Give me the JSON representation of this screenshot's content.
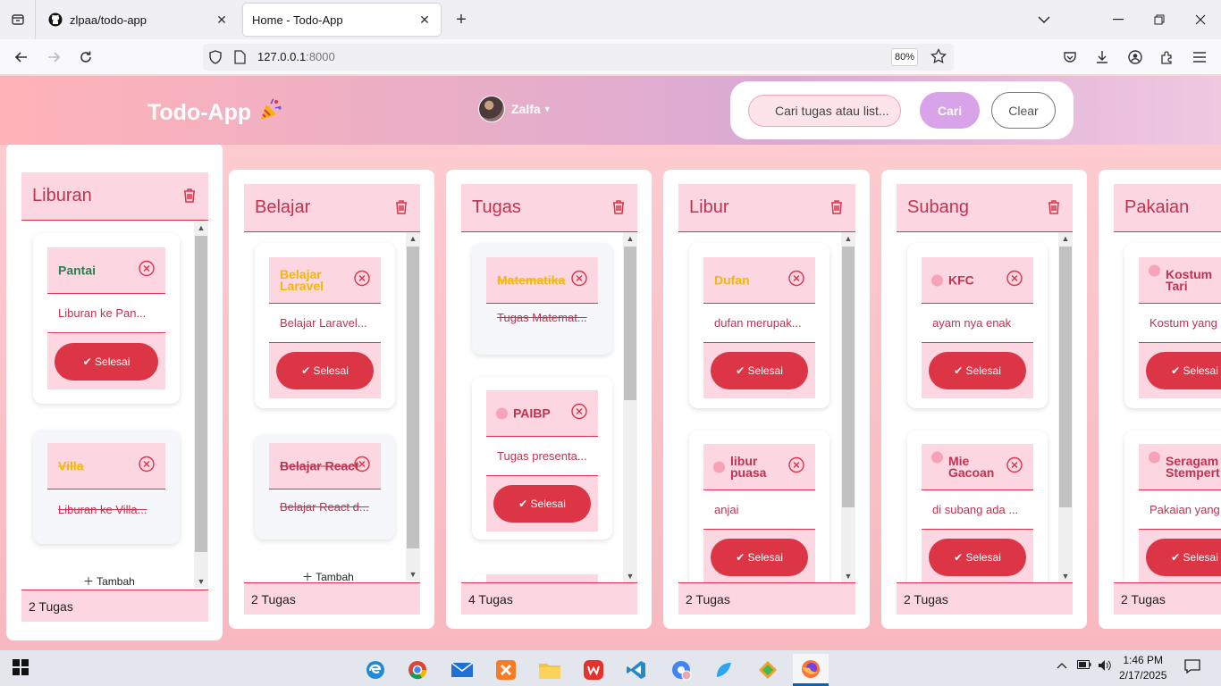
{
  "browser": {
    "tabs": [
      {
        "title": "zlpaa/todo-app"
      },
      {
        "title": "Home - Todo-App"
      }
    ],
    "url": {
      "host": "127.0.0.1",
      "port": ":8000"
    },
    "zoom": "80%"
  },
  "header": {
    "brand": "Todo-App",
    "user": "Zalfa",
    "search": {
      "placeholder": "Cari tugas atau list..."
    },
    "search_button": "Cari",
    "clear_button": "Clear"
  },
  "labels": {
    "selesai": "Selesai",
    "tambah": "Tambah"
  },
  "columns": [
    {
      "title": "Liburan",
      "count": "2 Tugas",
      "tasks": [
        {
          "title": "Pantai",
          "desc": "Liburan ke Pan...",
          "done": false
        },
        {
          "title": "Villa",
          "desc": "Liburan ke Villa...",
          "done": true
        }
      ]
    },
    {
      "title": "Belajar",
      "count": "2 Tugas",
      "tasks": [
        {
          "title": "Belajar Laravel",
          "desc": "Belajar Laravel...",
          "done": false
        },
        {
          "title": "Belajar React",
          "desc": "Belajar React d...",
          "done": true
        }
      ]
    },
    {
      "title": "Tugas",
      "count": "4 Tugas",
      "tasks": [
        {
          "title": "Matematika",
          "desc": "Tugas Matemat...",
          "done": true
        },
        {
          "title": "PAIBP",
          "desc": "Tugas presenta...",
          "done": false
        }
      ]
    },
    {
      "title": "Libur",
      "count": "2 Tugas",
      "tasks": [
        {
          "title": "Dufan",
          "desc": "dufan merupak...",
          "done": false
        },
        {
          "title": "libur puasa",
          "desc": "anjai",
          "done": false
        }
      ]
    },
    {
      "title": "Subang",
      "count": "2 Tugas",
      "tasks": [
        {
          "title": "KFC",
          "desc": "ayam nya enak",
          "done": false
        },
        {
          "title": "Mie Gacoan",
          "desc": "di subang ada ...",
          "done": false
        }
      ]
    },
    {
      "title": "Pakaian",
      "count": "2 Tugas",
      "tasks": [
        {
          "title": "Kostum Tari",
          "desc": "Kostum yang d",
          "done": false
        },
        {
          "title": "Seragam Stempert",
          "desc": "Pakaian yang",
          "done": false
        }
      ]
    }
  ],
  "taskbar": {
    "time": "1:46 PM",
    "date": "2/17/2025"
  },
  "colors": {
    "accent": "#dc3545",
    "card_header": "#fcd6e1",
    "search_button": "#d8a3e8"
  }
}
